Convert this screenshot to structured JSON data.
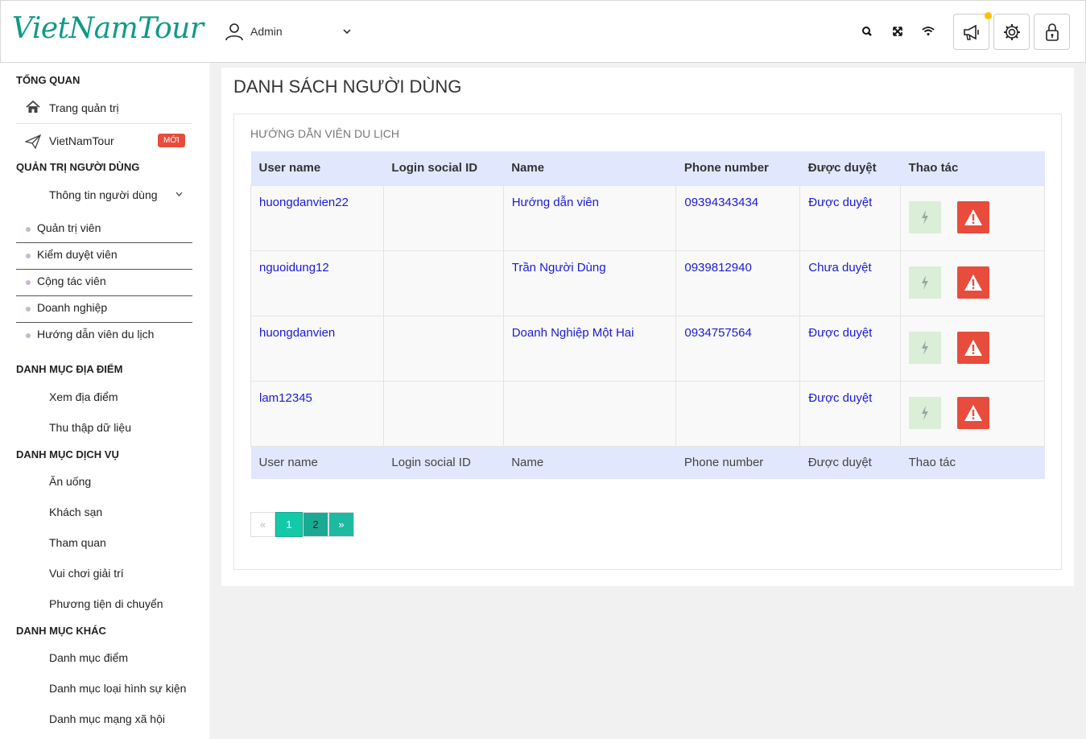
{
  "header": {
    "logo": "VietNamTour",
    "user_name": "Admin"
  },
  "sidebar": {
    "overview_title": "TỔNG QUAN",
    "admin_home": "Trang quản trị",
    "vietnamtour": "VietNamTour",
    "new_badge": "MỚI",
    "user_mgmt_title": "QUẢN TRỊ NGƯỜI DÙNG",
    "user_info": "Thông tin người dùng",
    "user_sub": [
      "Quản trị viên",
      "Kiểm duyệt viên",
      "Cộng tác viên",
      "Doanh nghiệp",
      "Hướng dẫn viên du lịch"
    ],
    "places_title": "DANH MỤC ĐỊA ĐIỂM",
    "places": [
      "Xem địa điểm",
      "Thu thập dữ liệu"
    ],
    "services_title": "DANH MỤC DỊCH VỤ",
    "services": [
      "Ăn uống",
      "Khách sạn",
      "Tham quan",
      "Vui chơi giải trí",
      "Phương tiện di chuyển"
    ],
    "other_title": "DANH MỤC KHÁC",
    "other": [
      "Danh mục điểm",
      "Danh mục loại hình sự kiện",
      "Danh mục mạng xã hội"
    ]
  },
  "main": {
    "page_title": "DANH SÁCH NGƯỜI DÙNG",
    "card_title": "HƯỚNG DẪN VIÊN DU LỊCH",
    "columns": [
      "User name",
      "Login social ID",
      "Name",
      "Phone number",
      "Được duyệt",
      "Thao tác"
    ],
    "rows": [
      {
        "username": "huongdanvien22",
        "social": "",
        "name": "Hướng dẫn viên",
        "phone": "09394343434",
        "status": "Được duyệt"
      },
      {
        "username": "nguoidung12",
        "social": "",
        "name": "Trần Người Dùng",
        "phone": "0939812940",
        "status": "Chưa duyệt"
      },
      {
        "username": "huongdanvien",
        "social": "",
        "name": "Doanh Nghiệp Một Hai",
        "phone": "0934757564",
        "status": "Được duyệt"
      },
      {
        "username": "lam12345",
        "social": "",
        "name": "",
        "phone": "",
        "status": "Được duyệt"
      }
    ],
    "pagination": {
      "prev": "«",
      "pages": [
        "1",
        "2"
      ],
      "current": "1",
      "next": "»"
    }
  },
  "colors": {
    "brand": "#0e9a86",
    "danger": "#e74c3c",
    "table_header": "#e1e7fd",
    "pager_active": "#14c9a8"
  }
}
